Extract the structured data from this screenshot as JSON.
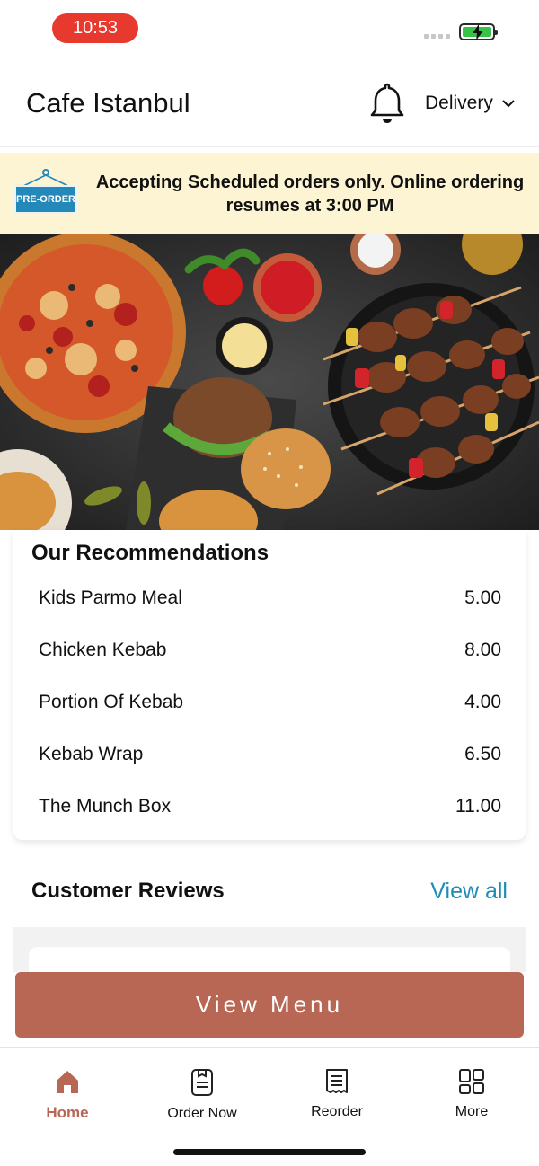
{
  "status": {
    "time": "10:53"
  },
  "header": {
    "title": "Cafe Istanbul",
    "mode_label": "Delivery"
  },
  "banner": {
    "tag_label": "PRE-ORDER",
    "message": "Accepting Scheduled orders only. Online ordering resumes at 3:00 PM"
  },
  "recommendations": {
    "title": "Our Recommendations",
    "items": [
      {
        "name": "Kids Parmo Meal",
        "price": "5.00"
      },
      {
        "name": "Chicken Kebab",
        "price": "8.00"
      },
      {
        "name": "Portion Of Kebab",
        "price": "4.00"
      },
      {
        "name": "Kebab Wrap",
        "price": "6.50"
      },
      {
        "name": "The Munch Box",
        "price": "11.00"
      }
    ]
  },
  "reviews": {
    "title": "Customer Reviews",
    "view_all_label": "View all"
  },
  "cta": {
    "view_menu_label": "View Menu"
  },
  "tabbar": {
    "tabs": [
      {
        "label": "Home",
        "icon": "home-icon",
        "active": true
      },
      {
        "label": "Order Now",
        "icon": "order-icon",
        "active": false
      },
      {
        "label": "Reorder",
        "icon": "receipt-icon",
        "active": false
      },
      {
        "label": "More",
        "icon": "grid-icon",
        "active": false
      }
    ]
  },
  "colors": {
    "accent": "#b86755",
    "link": "#1f8db3",
    "banner_bg": "#fdf4d3",
    "time_pill": "#e8392f"
  }
}
